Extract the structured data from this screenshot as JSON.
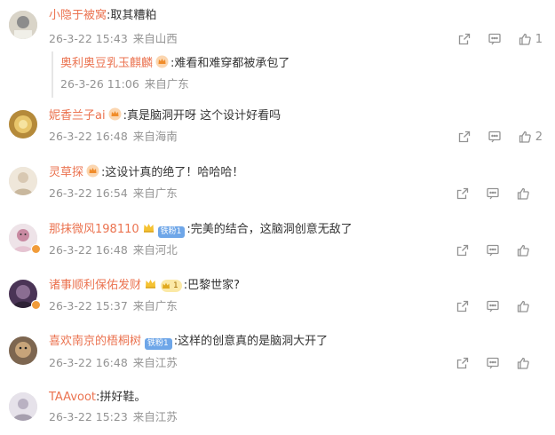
{
  "comments": [
    {
      "user": "小隐于被窝",
      "text": "取其糟粕",
      "date": "26-3-22 15:43",
      "loc": "来自山西",
      "likes": "1",
      "avatar": "#c9c4b8"
    },
    {
      "user": "妮香兰子ai",
      "text": "真是脑洞开呀  这个设计好看吗",
      "date": "26-3-22 16:48",
      "loc": "来自海南",
      "likes": "2",
      "avatar": "#c8a04a"
    },
    {
      "user": "灵草探",
      "text": "这设计真的绝了！哈哈哈！",
      "date": "26-3-22 16:54",
      "loc": "来自广东",
      "likes": "",
      "avatar": "#e6ddd0"
    },
    {
      "user": "那抹微风198110",
      "text": "完美的结合，这脑洞创意无敌了",
      "date": "26-3-22 16:48",
      "loc": "来自河北",
      "likes": "",
      "avatar": "#d9c7cf",
      "fan_badge": "铁粉1"
    },
    {
      "user": "诸事顺利保佑发财",
      "text": "巴黎世家?",
      "date": "26-3-22 15:37",
      "loc": "来自广东",
      "likes": "",
      "avatar": "#6b4a6e",
      "level": "1"
    },
    {
      "user": "喜欢南京的梧桐树",
      "text": "这样的创意真的是脑洞大开了",
      "date": "26-3-22 16:48",
      "loc": "来自江苏",
      "likes": "",
      "avatar": "#9a7a58",
      "fan_badge": "铁粉1"
    },
    {
      "user": "TAAvoot",
      "text": "拼好鞋。",
      "date": "26-3-22 15:23",
      "loc": "来自江苏",
      "likes": "",
      "avatar": "#d5d0d8"
    }
  ],
  "reply": {
    "user": "奥利奥豆乳玉麒麟",
    "text": "难看和难穿都被承包了",
    "date": "26-3-26 11:06",
    "loc": "来自广东"
  },
  "icons": {
    "repost": "repost-icon",
    "comment": "comment-icon",
    "like": "like-icon"
  }
}
